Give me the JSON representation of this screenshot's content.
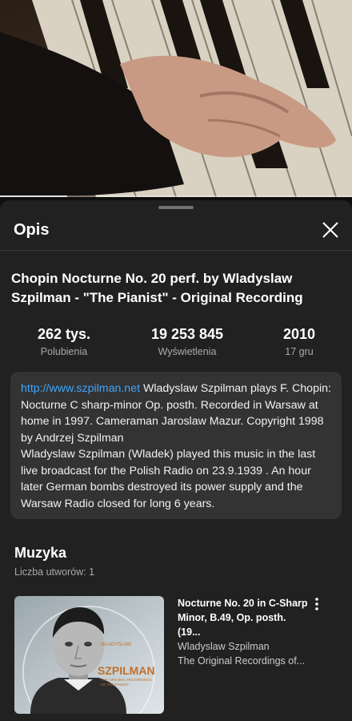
{
  "video": {
    "progress_fraction": 0.19
  },
  "sheet": {
    "title": "Opis",
    "close_icon": "close-icon"
  },
  "video_info": {
    "title": "Chopin Nocturne No. 20 perf. by Wladyslaw Szpilman - \"The Pianist\" - Original Recording",
    "stats": [
      {
        "value": "262 tys.",
        "label": "Polubienia"
      },
      {
        "value": "19 253 845",
        "label": "Wyświetlenia"
      },
      {
        "value": "2010",
        "label": "17 gru"
      }
    ]
  },
  "description": {
    "link": "http://www.szpilman.net",
    "text": " Wladyslaw Szpilman plays  F. Chopin: Nocturne C sharp-minor Op. posth. Recorded in Warsaw at home in 1997. Cameraman Jaroslaw Mazur. Copyright 1998 by Andrzej Szpilman\nWladyslaw Szpilman (Wladek) played this music in the last live broadcast for the Polish Radio on 23.9.1939 . An hour later German bombs destroyed its power supply and the Warsaw Radio closed for long 6 years."
  },
  "music": {
    "title": "Muzyka",
    "count": "Liczba utworów: 1",
    "track": {
      "title": "Nocturne No. 20 in C-Sharp Minor, B.49, Op. posth. (19...",
      "artist": "Wladyslaw Szpilman",
      "album": "The Original Recordings of...",
      "more_icon": "more-vert-icon"
    },
    "album_art": {
      "top_text": "WLADYSLAW",
      "name": "SZPILMAN",
      "sub1": "THE ORIGINAL RECORDINGS",
      "sub2": "OF THE PIANIST",
      "accent": "#c0702a"
    }
  }
}
